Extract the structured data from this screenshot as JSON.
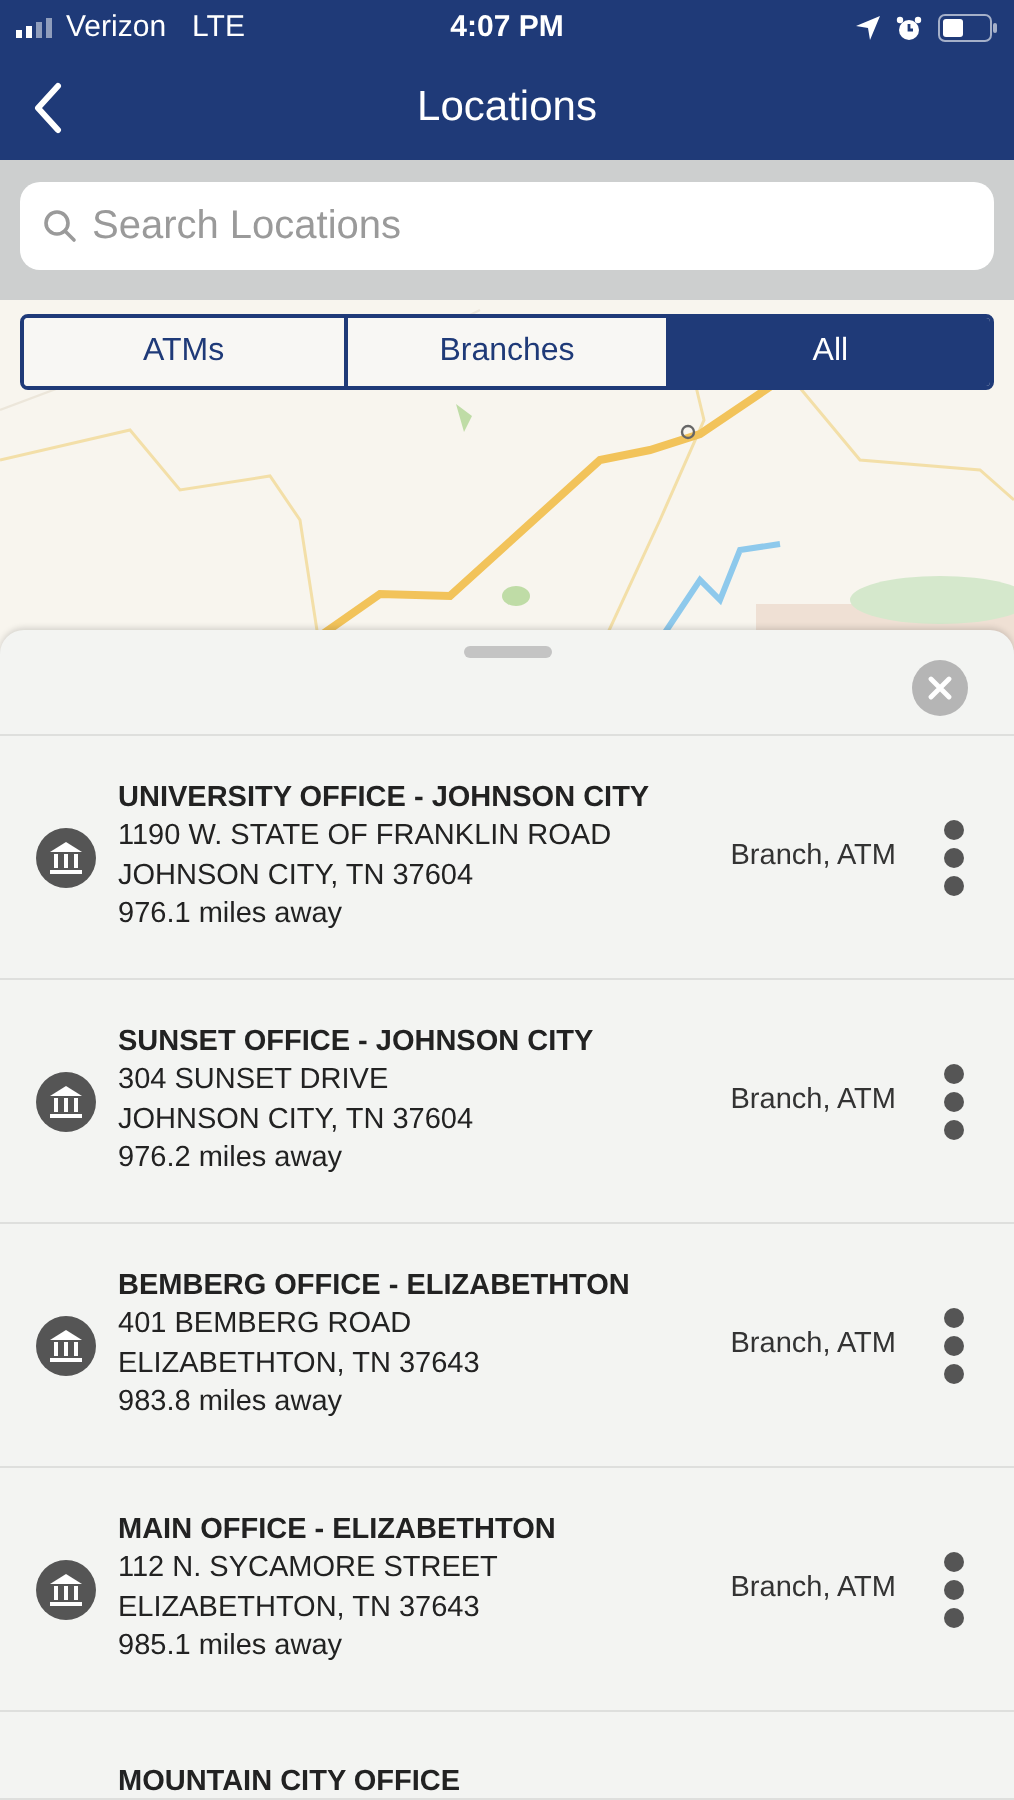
{
  "status_bar": {
    "carrier": "Verizon",
    "network": "LTE",
    "time": "4:07 PM"
  },
  "nav": {
    "title": "Locations"
  },
  "search": {
    "placeholder": "Search Locations"
  },
  "tabs": [
    {
      "label": "ATMs",
      "selected": false
    },
    {
      "label": "Branches",
      "selected": false
    },
    {
      "label": "All",
      "selected": true
    }
  ],
  "locations": [
    {
      "name": "UNIVERSITY OFFICE - JOHNSON CITY",
      "address": "1190 W. STATE OF FRANKLIN ROAD",
      "city": "JOHNSON CITY, TN 37604",
      "distance": "976.1 miles away",
      "services": "Branch, ATM"
    },
    {
      "name": "SUNSET OFFICE - JOHNSON CITY",
      "address": "304 SUNSET DRIVE",
      "city": "JOHNSON CITY, TN 37604",
      "distance": "976.2 miles away",
      "services": "Branch, ATM"
    },
    {
      "name": "BEMBERG OFFICE - ELIZABETHTON",
      "address": "401 BEMBERG ROAD",
      "city": "ELIZABETHTON, TN 37643",
      "distance": "983.8 miles away",
      "services": "Branch, ATM"
    },
    {
      "name": "MAIN OFFICE -  ELIZABETHTON",
      "address": "112 N. SYCAMORE STREET",
      "city": "ELIZABETHTON, TN 37643",
      "distance": "985.1 miles away",
      "services": "Branch, ATM"
    },
    {
      "name": "MOUNTAIN CITY OFFICE"
    }
  ]
}
